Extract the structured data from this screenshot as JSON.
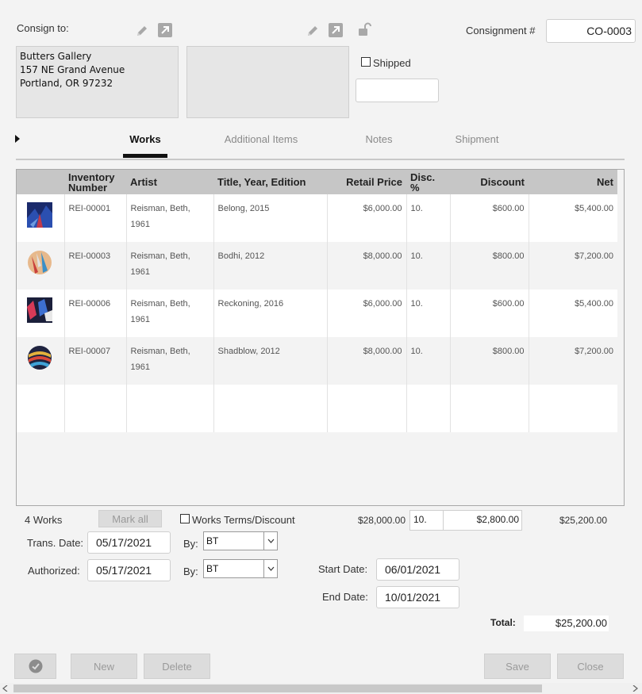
{
  "header": {
    "consign_to_label": "Consign to:",
    "address_lines": [
      "Butters Gallery",
      "157 NE Grand Avenue",
      "Portland, OR 97232"
    ],
    "shipped_label": "Shipped",
    "shipped_value": "",
    "consignment_label": "Consignment #",
    "consignment_number": "CO-0003"
  },
  "tabs": [
    {
      "label": "Works",
      "active": true
    },
    {
      "label": "Additional Items",
      "active": false
    },
    {
      "label": "Notes",
      "active": false
    },
    {
      "label": "Shipment",
      "active": false
    }
  ],
  "table": {
    "columns": [
      "",
      "Inventory Number",
      "Artist",
      "Title, Year, Edition",
      "Retail Price",
      "Disc. %",
      "Discount",
      "Net"
    ],
    "rows": [
      {
        "inventory": "REI-00001",
        "artist": "Reisman, Beth, 1961",
        "title": "Belong, 2015",
        "retail": "$6,000.00",
        "disc_pct": "10.",
        "discount": "$600.00",
        "net": "$5,400.00",
        "thumb": "thumb-belong"
      },
      {
        "inventory": "REI-00003",
        "artist": "Reisman, Beth, 1961",
        "title": "Bodhi, 2012",
        "retail": "$8,000.00",
        "disc_pct": "10.",
        "discount": "$800.00",
        "net": "$7,200.00",
        "thumb": "thumb-bodhi"
      },
      {
        "inventory": "REI-00006",
        "artist": "Reisman, Beth, 1961",
        "title": "Reckoning, 2016",
        "retail": "$6,000.00",
        "disc_pct": "10.",
        "discount": "$600.00",
        "net": "$5,400.00",
        "thumb": "thumb-reckoning"
      },
      {
        "inventory": "REI-00007",
        "artist": "Reisman, Beth, 1961",
        "title": "Shadblow, 2012",
        "retail": "$8,000.00",
        "disc_pct": "10.",
        "discount": "$800.00",
        "net": "$7,200.00",
        "thumb": "thumb-shadblow"
      }
    ]
  },
  "summary": {
    "works_count": "4 Works",
    "mark_all": "Mark all",
    "terms_label": "Works Terms/Discount",
    "total_retail": "$28,000.00",
    "total_disc_pct": "10.",
    "total_discount": "$2,800.00",
    "total_net": "$25,200.00"
  },
  "form": {
    "trans_date_label": "Trans. Date:",
    "trans_date": "05/17/2021",
    "by_label": "By:",
    "trans_by": "BT",
    "authorized_label": "Authorized:",
    "authorized_date": "05/17/2021",
    "authorized_by": "BT",
    "start_date_label": "Start Date:",
    "start_date": "06/01/2021",
    "end_date_label": "End Date:",
    "end_date": "10/01/2021",
    "total_label": "Total:",
    "total_value": "$25,200.00"
  },
  "buttons": {
    "new": "New",
    "delete": "Delete",
    "save": "Save",
    "close": "Close"
  },
  "colors": {
    "background": "#f3f3f3",
    "header_row": "#c6c6c6",
    "address_box": "#e6e6e6",
    "button": "#dcdcdc"
  }
}
